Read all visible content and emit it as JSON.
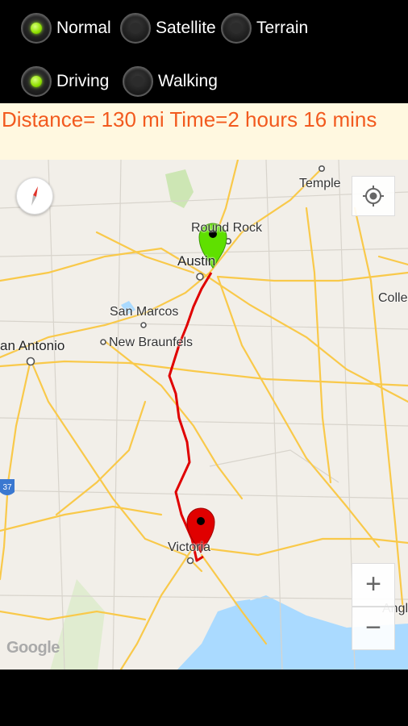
{
  "map_type": {
    "options": [
      {
        "label": "Normal",
        "selected": true
      },
      {
        "label": "Satellite",
        "selected": false
      },
      {
        "label": "Terrain",
        "selected": false
      }
    ]
  },
  "travel_mode": {
    "options": [
      {
        "label": "Driving",
        "selected": true
      },
      {
        "label": "Walking",
        "selected": false
      }
    ]
  },
  "route_info": {
    "text": "Distance= 130 mi   Time=2 hours 16 mins"
  },
  "map": {
    "labels": {
      "temple": "Temple",
      "round_rock": "Round Rock",
      "austin": "Austin",
      "college": "Colle",
      "san_marcos": "San Marcos",
      "san_antonio": "an Antonio",
      "new_braunfels": "New Braunfels",
      "victoria": "Victoria",
      "angleton": "Angl",
      "highway_shield": "37"
    },
    "attribution": "Google",
    "zoom_in_label": "+",
    "zoom_out_label": "−",
    "colors": {
      "route": "#e00000",
      "start_marker": "#5fe000",
      "end_marker": "#e00000",
      "highway": "#f9c94a",
      "water": "#aadaff",
      "park": "#cde6b4"
    }
  }
}
